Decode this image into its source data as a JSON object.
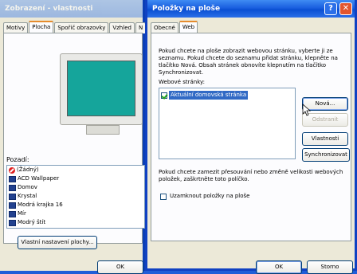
{
  "bg_window": {
    "title": "Zobrazení - vlastnosti",
    "tabs": [
      "Motivy",
      "Plocha",
      "Spořič obrazovky",
      "Vzhled",
      "N"
    ],
    "background_label": "Pozadí:",
    "backgrounds": [
      "(Žádný)",
      "ACD Wallpaper",
      "Domov",
      "Krystal",
      "Modrá krajka 16",
      "Mír",
      "Modrý štít"
    ],
    "customize_button": "Vlastní nastavení plochy...",
    "ok_button": "OK"
  },
  "dialog": {
    "title": "Položky na ploše",
    "help_glyph": "?",
    "close_glyph": "✕",
    "tabs": [
      "Obecné",
      "Web"
    ],
    "description": [
      "Pokud chcete na ploše zobrazit webovou stránku, vyberte ji ze",
      "seznamu. Pokud chcete do seznamu přidat stránku, klepněte na",
      "tlačítko Nová. Obsah stránek obnovíte klepnutím na tlačítko",
      "Synchronizovat."
    ],
    "pages_label": "Webové stránky:",
    "pages": [
      "Aktuální domovská stránka"
    ],
    "buttons": {
      "new": "Nová...",
      "delete": "Odstranit",
      "properties": "Vlastnosti",
      "synchronize": "Synchronizovat"
    },
    "lock_text": [
      "Pokud chcete zamezit přesouvání nebo změně velikosti webových",
      "položek, zaškrtněte toto políčko."
    ],
    "lock_checkbox_label": "Uzamknout položky na ploše",
    "ok_button": "OK",
    "cancel_button": "Storno"
  }
}
